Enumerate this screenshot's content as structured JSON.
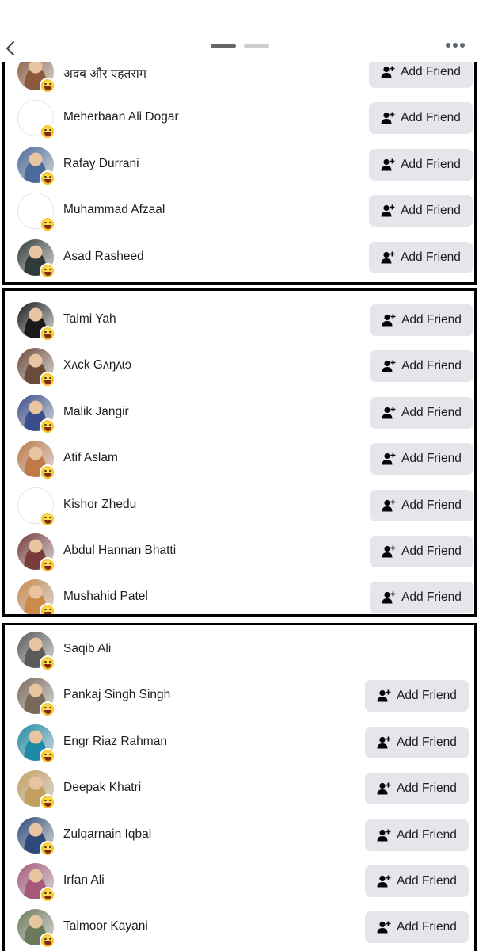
{
  "header": {
    "back_icon": "chevron-left-icon",
    "pager_pages": 2,
    "more_icon": "more-horizontal-icon"
  },
  "add_friend_label": "Add Friend",
  "groups": [
    {
      "rows": [
        {
          "name": "अदब और एहतराम",
          "avatar": "photo",
          "tone": "#8b5a3c",
          "add": true
        },
        {
          "name": "Meherbaan Ali Dogar",
          "avatar": "empty",
          "add": true
        },
        {
          "name": "Rafay Durrani",
          "avatar": "photo",
          "tone": "#4a6a9a",
          "add": true
        },
        {
          "name": "Muhammad Afzaal",
          "avatar": "empty",
          "add": true
        },
        {
          "name": "Asad Rasheed",
          "avatar": "photo",
          "tone": "#2f3b3a",
          "add": true
        }
      ]
    },
    {
      "rows": [
        {
          "name": "Taimi Yah",
          "avatar": "photo",
          "tone": "#1a1a1a",
          "add": true
        },
        {
          "name": "Xʌck Gʌŋʌɩɘ",
          "avatar": "photo",
          "tone": "#6b4a3a",
          "add": true
        },
        {
          "name": "Malik Jangir",
          "avatar": "photo",
          "tone": "#3b4e8c",
          "add": true
        },
        {
          "name": "Atif Aslam",
          "avatar": "photo",
          "tone": "#c07a4a",
          "add": true
        },
        {
          "name": "Kishor Zhedu",
          "avatar": "empty",
          "add": true
        },
        {
          "name": "Abdul Hannan Bhatti",
          "avatar": "photo",
          "tone": "#7a3b3b",
          "add": true
        },
        {
          "name": "Mushahid Patel",
          "avatar": "photo",
          "tone": "#c98a4a",
          "add": true
        }
      ]
    },
    {
      "rows": [
        {
          "name": "Saqib Ali",
          "avatar": "photo",
          "tone": "#5a5a5a",
          "add": false
        },
        {
          "name": "Pankaj Singh Singh",
          "avatar": "photo",
          "tone": "#7a6a5a",
          "add": true
        },
        {
          "name": "Engr Riaz Rahman",
          "avatar": "photo",
          "tone": "#1f8aa8",
          "add": true
        },
        {
          "name": "Deepak Khatri",
          "avatar": "photo",
          "tone": "#c4a060",
          "add": true
        },
        {
          "name": "Zulqarnain Iqbal",
          "avatar": "photo",
          "tone": "#2e4a7a",
          "add": true
        },
        {
          "name": "Irfan Ali",
          "avatar": "photo",
          "tone": "#a55a7a",
          "add": true
        },
        {
          "name": "Taimoor Kayani",
          "avatar": "photo",
          "tone": "#6a7a5a",
          "add": true
        }
      ]
    }
  ]
}
